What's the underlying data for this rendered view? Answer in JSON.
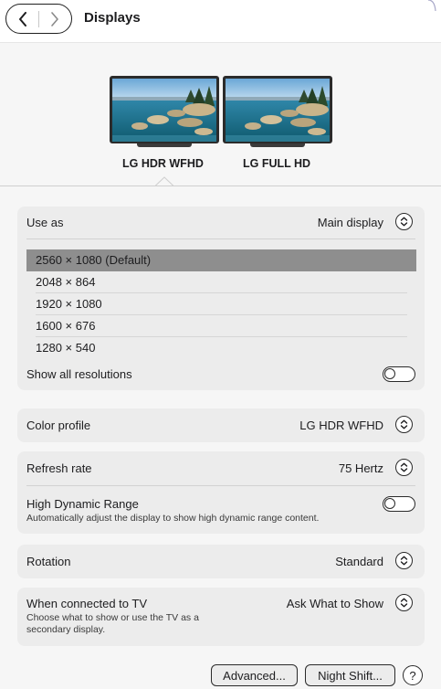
{
  "window": {
    "title": "Displays"
  },
  "monitors": [
    {
      "name": "LG HDR WFHD",
      "selected": true
    },
    {
      "name": "LG FULL HD",
      "selected": false
    }
  ],
  "use_as": {
    "label": "Use as",
    "value": "Main display"
  },
  "resolutions": {
    "items": [
      "2560 × 1080 (Default)",
      "2048 × 864",
      "1920 × 1080",
      "1600 × 676",
      "1280 × 540"
    ],
    "selected_index": 0,
    "show_all_label": "Show all resolutions",
    "show_all_on": false
  },
  "color_profile": {
    "label": "Color profile",
    "value": "LG HDR WFHD"
  },
  "refresh_rate": {
    "label": "Refresh rate",
    "value": "75 Hertz"
  },
  "hdr": {
    "label": "High Dynamic Range",
    "description": "Automatically adjust the display to show high dynamic range content.",
    "on": false
  },
  "rotation": {
    "label": "Rotation",
    "value": "Standard"
  },
  "tv": {
    "label": "When connected to TV",
    "description": "Choose what to show or use the TV as a secondary display.",
    "value": "Ask What to Show"
  },
  "buttons": {
    "advanced": "Advanced...",
    "night_shift": "Night Shift...",
    "help": "?"
  },
  "colors": {
    "selected_row": "#8e8e8e",
    "card_bg": "#ececec",
    "page_bg": "#f6f6f6"
  },
  "icons": {
    "back": "chevron-left-icon",
    "forward": "chevron-right-icon",
    "stepper": "up-down-chevron-icon"
  }
}
